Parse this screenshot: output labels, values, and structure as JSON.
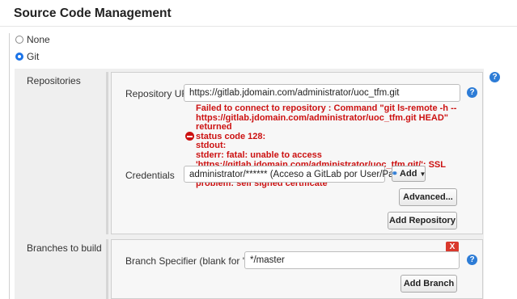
{
  "section": {
    "title": "Source Code Management"
  },
  "scm_options": [
    {
      "label": "None",
      "selected": false
    },
    {
      "label": "Git",
      "selected": true
    }
  ],
  "repositories": {
    "label": "Repositories",
    "url_label": "Repository URL",
    "url_value": "https://gitlab.jdomain.com/administrator/uoc_tfm.git",
    "error_lines": [
      "Failed to connect to repository : Command \"git ls-remote -h --",
      "https://gitlab.jdomain.com/administrator/uoc_tfm.git HEAD\" returned",
      "status code 128:",
      "stdout:",
      "stderr: fatal: unable to access",
      "'https://gitlab.jdomain.com/administrator/uoc_tfm.git/': SSL certificate",
      "problem: self signed certificate"
    ],
    "credentials_label": "Credentials",
    "credentials_value": "administrator/****** (Acceso a GitLab por User/Pass)",
    "add_label": "Add",
    "advanced_label": "Advanced...",
    "add_repository_label": "Add Repository"
  },
  "branches": {
    "label": "Branches to build",
    "specifier_label": "Branch Specifier (blank for 'any')",
    "specifier_value": "*/master",
    "delete_label": "X",
    "add_branch_label": "Add Branch"
  },
  "help_glyph": "?",
  "colors": {
    "error": "#cc1111",
    "help": "#2d7cd6",
    "radio_selected": "#1a73e8",
    "delete": "#d9382c"
  }
}
